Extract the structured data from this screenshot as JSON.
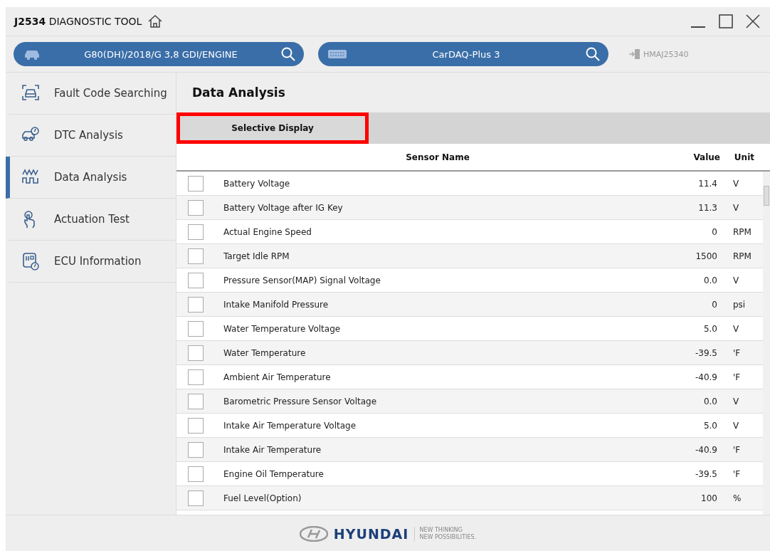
{
  "window": {
    "title_bold": "J2534",
    "title": "DIAGNOSTIC TOOL"
  },
  "vehicle_search": {
    "value": "G80(DH)/2018/G 3,8 GDI/ENGINE"
  },
  "device_search": {
    "value": "CarDAQ-Plus 3"
  },
  "device_id": "HMAJ25340",
  "sidebar": {
    "items": [
      {
        "label": "Fault Code Searching",
        "selected": false
      },
      {
        "label": "DTC Analysis",
        "selected": false
      },
      {
        "label": "Data Analysis",
        "selected": true
      },
      {
        "label": "Actuation Test",
        "selected": false
      },
      {
        "label": "ECU Information",
        "selected": false
      }
    ]
  },
  "page_title": "Data Analysis",
  "toolbar": {
    "button": "Selective Display",
    "highlighted": true
  },
  "table": {
    "columns": [
      "Sensor Name",
      "Value",
      "Unit"
    ],
    "rows": [
      {
        "checked": false,
        "name": "Battery Voltage",
        "value": "11.4",
        "unit": "V"
      },
      {
        "checked": false,
        "name": "Battery Voltage after IG Key",
        "value": "11.3",
        "unit": "V"
      },
      {
        "checked": false,
        "name": "Actual Engine Speed",
        "value": "0",
        "unit": "RPM"
      },
      {
        "checked": false,
        "name": "Target Idle RPM",
        "value": "1500",
        "unit": "RPM"
      },
      {
        "checked": false,
        "name": "Pressure Sensor(MAP) Signal Voltage",
        "value": "0.0",
        "unit": "V"
      },
      {
        "checked": false,
        "name": "Intake Manifold Pressure",
        "value": "0",
        "unit": "psi"
      },
      {
        "checked": false,
        "name": "Water Temperature Voltage",
        "value": "5.0",
        "unit": "V"
      },
      {
        "checked": false,
        "name": "Water Temperature",
        "value": "-39.5",
        "unit": "'F"
      },
      {
        "checked": false,
        "name": "Ambient Air Temperature",
        "value": "-40.9",
        "unit": "'F"
      },
      {
        "checked": false,
        "name": "Barometric Pressure Sensor Voltage",
        "value": "0.0",
        "unit": "V"
      },
      {
        "checked": false,
        "name": "Intake Air Temperature Voltage",
        "value": "5.0",
        "unit": "V"
      },
      {
        "checked": false,
        "name": "Intake Air Temperature",
        "value": "-40.9",
        "unit": "'F"
      },
      {
        "checked": false,
        "name": "Engine Oil Temperature",
        "value": "-39.5",
        "unit": "'F"
      },
      {
        "checked": false,
        "name": "Fuel Level(Option)",
        "value": "100",
        "unit": "%"
      }
    ]
  },
  "footer": {
    "brand": "HYUNDAI",
    "tagline": [
      "NEW THINKING",
      "NEW POSSIBILITIES."
    ]
  }
}
